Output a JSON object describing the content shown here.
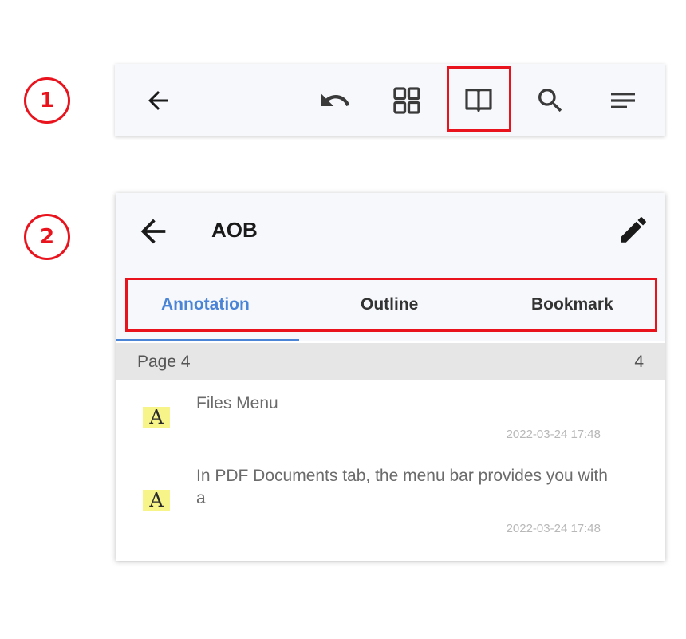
{
  "steps": [
    "1",
    "2"
  ],
  "toolbar": {
    "buttons": [
      "back-icon",
      "undo-icon",
      "grid-icon",
      "book-icon",
      "search-icon",
      "menu-icon"
    ],
    "highlighted": "book-icon",
    "highlight_color": "#e8131d"
  },
  "panel": {
    "title": "AOB",
    "tabs": [
      {
        "label": "Annotation",
        "active": true
      },
      {
        "label": "Outline",
        "active": false
      },
      {
        "label": "Bookmark",
        "active": false
      }
    ],
    "active_color": "#4a84d6",
    "page_row": {
      "label": "Page  4",
      "count": "4"
    },
    "annotations": [
      {
        "icon_letter": "A",
        "text": "Files Menu",
        "date": "2022-03-24 17:48"
      },
      {
        "icon_letter": "A",
        "text": "In PDF Documents tab, the menu bar provides you with a",
        "date": "2022-03-24 17:48"
      }
    ]
  }
}
